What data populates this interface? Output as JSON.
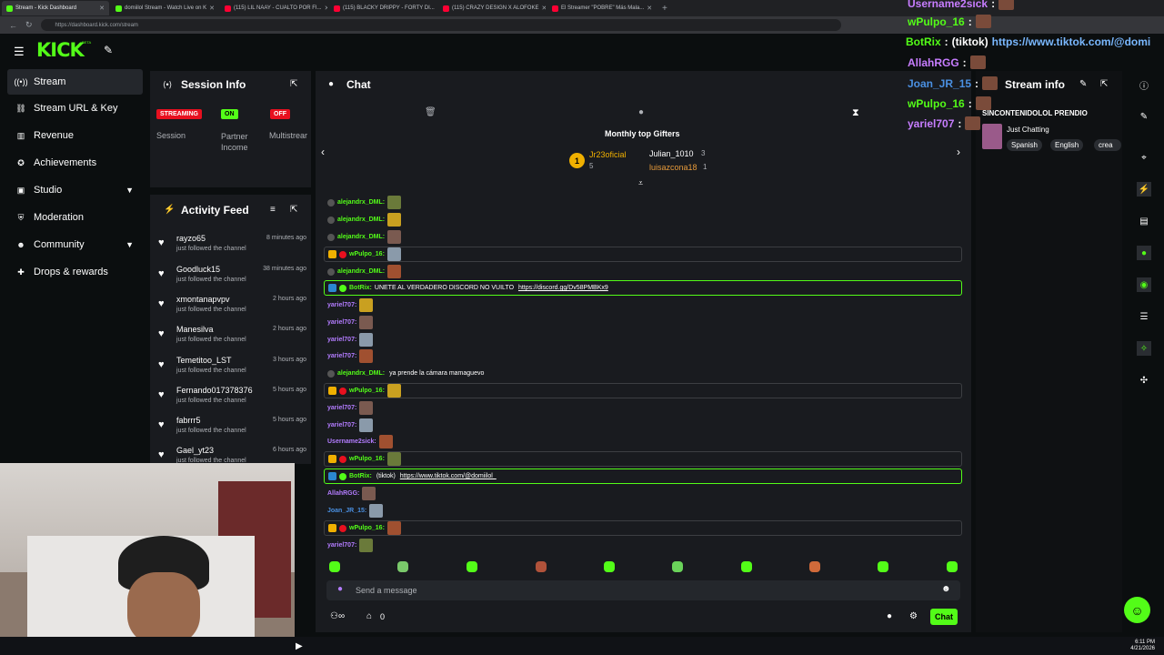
{
  "browser": {
    "tabs": [
      {
        "title": "Stream - Kick Dashboard",
        "color": "#53fc18",
        "active": true
      },
      {
        "title": "domiilol Stream - Watch Live on K",
        "color": "#53fc18",
        "active": false
      },
      {
        "title": "(115) LIL NAAY - CUALTO POR FI...",
        "color": "#ff0033",
        "active": false
      },
      {
        "title": "(115) BLACKY DRIPPY - FORTY DI...",
        "color": "#ff0033",
        "active": false
      },
      {
        "title": "(115) CRAZY DESIGN X ALOFOKE",
        "color": "#ff0033",
        "active": false
      },
      {
        "title": "El Streamer \"POBRE\" Más Mala...",
        "color": "#ff0033",
        "active": false
      }
    ],
    "url": "https://dashboard.kick.com/stream"
  },
  "brand": {
    "logo": "KICK",
    "beta": "BETA",
    "accent": "#53fc18"
  },
  "sidebar": {
    "items": [
      {
        "label": "Stream",
        "icon": "broadcast-icon"
      },
      {
        "label": "Stream URL & Key",
        "icon": "link-icon"
      },
      {
        "label": "Revenue",
        "icon": "chart-icon"
      },
      {
        "label": "Achievements",
        "icon": "trophy-icon"
      },
      {
        "label": "Studio",
        "icon": "studio-icon"
      },
      {
        "label": "Moderation",
        "icon": "shield-icon"
      },
      {
        "label": "Community",
        "icon": "community-icon"
      },
      {
        "label": "Drops & rewards",
        "icon": "gift-icon"
      }
    ]
  },
  "session": {
    "title": "Session Info",
    "statuses": [
      {
        "badge": "STREAMING",
        "label": "Session",
        "color": "#e8101f"
      },
      {
        "badge": "ON",
        "label": "Partner Income",
        "color": "#53fc18"
      },
      {
        "badge": "OFF",
        "label": "Multistrear",
        "color": "#e8101f"
      }
    ]
  },
  "activity": {
    "title": "Activity Feed",
    "items": [
      {
        "name": "rayzo65",
        "sub": "just followed the channel",
        "time": "8 minutes ago"
      },
      {
        "name": "Goodluck15",
        "sub": "just followed the channel",
        "time": "38 minutes ago"
      },
      {
        "name": "xmontanapvpv",
        "sub": "just followed the channel",
        "time": "2 hours ago"
      },
      {
        "name": "Manesilva",
        "sub": "just followed the channel",
        "time": "2 hours ago"
      },
      {
        "name": "Temetitoo_LST",
        "sub": "just followed the channel",
        "time": "3 hours ago"
      },
      {
        "name": "Fernando017378376",
        "sub": "just followed the channel",
        "time": "5 hours ago"
      },
      {
        "name": "fabrrr5",
        "sub": "just followed the channel",
        "time": "5 hours ago"
      },
      {
        "name": "Gael_yt23",
        "sub": "just followed the channel",
        "time": "6 hours ago"
      }
    ]
  },
  "chat": {
    "title": "Chat",
    "gifters_title": "Monthly top Gifters",
    "gifters": [
      {
        "rank": "1",
        "name": "Jr23oficial",
        "count": "5"
      },
      {
        "name": "Julian_1010",
        "count": "3"
      },
      {
        "name": "luisazcona18",
        "count": "1"
      }
    ],
    "messages": [
      {
        "user": "alejandrx_DML:",
        "text": "",
        "color": "#53fc18",
        "style": ""
      },
      {
        "user": "alejandrx_DML:",
        "text": "",
        "color": "#53fc18",
        "style": ""
      },
      {
        "user": "alejandrx_DML:",
        "text": "",
        "color": "#53fc18",
        "style": ""
      },
      {
        "user": "wPulpo_16:",
        "text": "",
        "color": "#53fc18",
        "style": "hl"
      },
      {
        "user": "alejandrx_DML:",
        "text": "",
        "color": "#53fc18",
        "style": ""
      },
      {
        "user": "BotRix:",
        "text": "UNETE AL VERDADERO DISCORD NO VUILTO ",
        "link": "https://discord.gg/Dv58PMBKx9",
        "color": "#53fc18",
        "style": "hlg"
      },
      {
        "user": "yariel707:",
        "text": "",
        "color": "#b37cff",
        "style": ""
      },
      {
        "user": "yariel707:",
        "text": "",
        "color": "#b37cff",
        "style": ""
      },
      {
        "user": "yariel707:",
        "text": "",
        "color": "#b37cff",
        "style": ""
      },
      {
        "user": "yariel707:",
        "text": "",
        "color": "#b37cff",
        "style": ""
      },
      {
        "user": "alejandrx_DML:",
        "text": " ya prende la cámara mamaguevo",
        "color": "#53fc18",
        "style": ""
      },
      {
        "user": "wPulpo_16:",
        "text": "",
        "color": "#53fc18",
        "style": "hl"
      },
      {
        "user": "yariel707:",
        "text": "",
        "color": "#b37cff",
        "style": ""
      },
      {
        "user": "yariel707:",
        "text": "",
        "color": "#b37cff",
        "style": ""
      },
      {
        "user": "Username2sick:",
        "text": "",
        "color": "#b37cff",
        "style": ""
      },
      {
        "user": "wPulpo_16:",
        "text": "",
        "color": "#53fc18",
        "style": "hl"
      },
      {
        "user": "BotRix:",
        "text": " (tiktok) ",
        "link": "https://www.tiktok.com/@domiilol_",
        "color": "#53fc18",
        "style": "hlg"
      },
      {
        "user": "AllahRGG:",
        "text": "",
        "color": "#b37cff",
        "style": ""
      },
      {
        "user": "Joan_JR_15:",
        "text": "",
        "color": "#4a90e2",
        "style": ""
      },
      {
        "user": "wPulpo_16:",
        "text": "",
        "color": "#53fc18",
        "style": "hl"
      },
      {
        "user": "yariel707:",
        "text": "",
        "color": "#b37cff",
        "style": ""
      }
    ],
    "input_placeholder": "Send a message",
    "send_label": "Chat",
    "viewer_count": "0"
  },
  "stream_info": {
    "title": "Stream info",
    "stream_title": "SINCONTENIDOLOL PRENDIO",
    "category": "Just Chatting",
    "tags": [
      "Spanish",
      "English",
      "crea"
    ]
  },
  "overlay_chat": [
    {
      "user": "Username2sick",
      "text": "",
      "color": "#c77dff"
    },
    {
      "user": "wPulpo_16",
      "text": "",
      "color": "#53fc18"
    },
    {
      "user": "BotRix",
      "text": "(tiktok)",
      "link": "https://www.tiktok.com/@domi",
      "color": "#53fc18"
    },
    {
      "user": "AllahRGG",
      "text": "",
      "color": "#c77dff"
    },
    {
      "user": "Joan_JR_15",
      "text": "",
      "color": "#4a90e2"
    },
    {
      "user": "wPulpo_16",
      "text": "",
      "color": "#53fc18"
    },
    {
      "user": "yariel707",
      "text": "",
      "color": "#c77dff"
    }
  ],
  "taskbar": {
    "time": "6:11 PM",
    "date": "4/21/2026"
  }
}
